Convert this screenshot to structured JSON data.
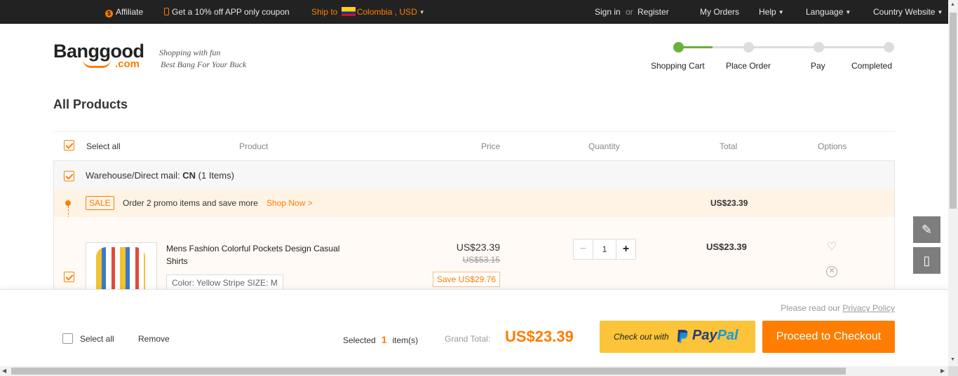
{
  "topbar": {
    "affiliate": "Affiliate",
    "coupon": "Get a 10% off APP only coupon",
    "ship_to_label": "Ship to",
    "ship_to_value": "Colombia , USD",
    "sign_in": "Sign in",
    "or": "or",
    "register": "Register",
    "my_orders": "My Orders",
    "help": "Help",
    "language": "Language",
    "country_website": "Country Website"
  },
  "logo": {
    "word": "Banggood",
    "domain": ".com",
    "tagline_1": "Shopping with fun",
    "tagline_2": "Best Bang For Your Buck"
  },
  "steps": [
    {
      "label": "Shopping Cart",
      "active": true
    },
    {
      "label": "Place Order",
      "active": false
    },
    {
      "label": "Pay",
      "active": false
    },
    {
      "label": "Completed",
      "active": false
    }
  ],
  "page_title": "All Products",
  "table_header": {
    "select_all": "Select all",
    "product": "Product",
    "price": "Price",
    "quantity": "Quantity",
    "total": "Total",
    "options": "Options"
  },
  "group": {
    "label_prefix": "Warehouse/Direct mail:",
    "warehouse": "CN",
    "count": "(1 Items)",
    "promo": {
      "badge": "SALE",
      "text": "Order 2 promo items and save more",
      "link": "Shop Now >",
      "amount": "US$23.39"
    },
    "item": {
      "name": "Mens Fashion Colorful Pockets Design Casual Shirts",
      "attributes": "Color: Yellow Stripe SIZE: M",
      "price": "US$23.39",
      "original_price": "US$53.15",
      "save": "Save US$29.76",
      "quantity": "1",
      "total": "US$23.39"
    }
  },
  "bottom": {
    "privacy_prefix": "Please read our",
    "privacy_link": "Privacy Policy",
    "select_all": "Select all",
    "remove": "Remove",
    "selected_label": "Selected",
    "selected_count": "1",
    "selected_suffix": "item(s)",
    "grand_total_label": "Grand Total:",
    "grand_total": "US$23.39",
    "paypal_label": "Check out with",
    "paypal_brand_1": "Pay",
    "paypal_brand_2": "Pal",
    "checkout": "Proceed to Checkout"
  },
  "colors": {
    "accent": "#ff7d00",
    "progress_active": "#6ab23c",
    "topbar_bg": "#222222",
    "paypal_bg": "#fcc439"
  }
}
